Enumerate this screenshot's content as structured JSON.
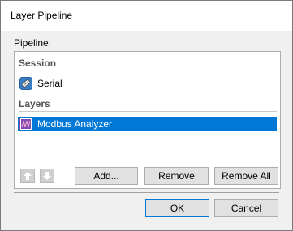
{
  "window": {
    "title": "Layer Pipeline"
  },
  "pipeline": {
    "label": "Pipeline:",
    "groups": [
      {
        "header": "Session",
        "items": [
          {
            "label": "Serial",
            "icon": "serial-cable-icon",
            "selected": false
          }
        ]
      },
      {
        "header": "Layers",
        "items": [
          {
            "label": "Modbus Analyzer",
            "icon": "modbus-analyzer-icon",
            "selected": true
          }
        ]
      }
    ]
  },
  "buttons": {
    "move_up_icon": "arrow-up-icon",
    "move_down_icon": "arrow-down-icon",
    "add": "Add...",
    "remove": "Remove",
    "remove_all": "Remove All",
    "ok": "OK",
    "cancel": "Cancel"
  },
  "colors": {
    "selection": "#0078d7",
    "dialog_bg": "#f0f0f0",
    "default_button_border": "#0078d7"
  }
}
